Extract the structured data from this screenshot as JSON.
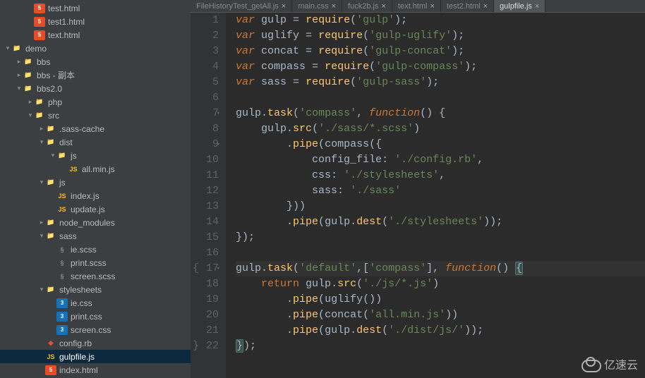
{
  "tabs": [
    {
      "label": "FileHistoryTest_getAll.js",
      "active": false,
      "closeable": true
    },
    {
      "label": "main.css",
      "active": false,
      "closeable": true
    },
    {
      "label": "fuck2b.js",
      "active": false,
      "closeable": true
    },
    {
      "label": "text.html",
      "active": false,
      "closeable": true
    },
    {
      "label": "test2.html",
      "active": false,
      "closeable": true
    },
    {
      "label": "gulpfile.js",
      "active": true,
      "closeable": true
    }
  ],
  "sidebar": {
    "tree": [
      {
        "depth": 2,
        "arrow": "",
        "icon": "html5",
        "iconText": "5",
        "name": "test.html"
      },
      {
        "depth": 2,
        "arrow": "",
        "icon": "html5",
        "iconText": "5",
        "name": "test1.html"
      },
      {
        "depth": 2,
        "arrow": "",
        "icon": "html5",
        "iconText": "5",
        "name": "text.html"
      },
      {
        "depth": 0,
        "arrow": "▾",
        "icon": "folder",
        "iconText": "📁",
        "name": "demo"
      },
      {
        "depth": 1,
        "arrow": "▸",
        "icon": "folder",
        "iconText": "📁",
        "name": "bbs"
      },
      {
        "depth": 1,
        "arrow": "▸",
        "icon": "folder",
        "iconText": "📁",
        "name": "bbs - 副本"
      },
      {
        "depth": 1,
        "arrow": "▾",
        "icon": "folder",
        "iconText": "📁",
        "name": "bbs2.0"
      },
      {
        "depth": 2,
        "arrow": "▸",
        "icon": "folder",
        "iconText": "📁",
        "name": "php"
      },
      {
        "depth": 2,
        "arrow": "▾",
        "icon": "folder",
        "iconText": "📁",
        "name": "src"
      },
      {
        "depth": 3,
        "arrow": "▸",
        "icon": "folder",
        "iconText": "📁",
        "name": ".sass-cache"
      },
      {
        "depth": 3,
        "arrow": "▾",
        "icon": "folder",
        "iconText": "📁",
        "name": "dist"
      },
      {
        "depth": 4,
        "arrow": "▾",
        "icon": "folder",
        "iconText": "📁",
        "name": "js"
      },
      {
        "depth": 5,
        "arrow": "",
        "icon": "js",
        "iconText": "JS",
        "name": "all.min.js"
      },
      {
        "depth": 3,
        "arrow": "▾",
        "icon": "folder",
        "iconText": "📁",
        "name": "js"
      },
      {
        "depth": 4,
        "arrow": "",
        "icon": "js",
        "iconText": "JS",
        "name": "index.js"
      },
      {
        "depth": 4,
        "arrow": "",
        "icon": "js",
        "iconText": "JS",
        "name": "update.js"
      },
      {
        "depth": 3,
        "arrow": "▸",
        "icon": "folder",
        "iconText": "📁",
        "name": "node_modules"
      },
      {
        "depth": 3,
        "arrow": "▾",
        "icon": "folder",
        "iconText": "📁",
        "name": "sass"
      },
      {
        "depth": 4,
        "arrow": "",
        "icon": "sass",
        "iconText": "§",
        "name": "ie.scss"
      },
      {
        "depth": 4,
        "arrow": "",
        "icon": "sass",
        "iconText": "§",
        "name": "print.scss"
      },
      {
        "depth": 4,
        "arrow": "",
        "icon": "sass",
        "iconText": "§",
        "name": "screen.scss"
      },
      {
        "depth": 3,
        "arrow": "▾",
        "icon": "folder",
        "iconText": "📁",
        "name": "stylesheets"
      },
      {
        "depth": 4,
        "arrow": "",
        "icon": "css",
        "iconText": "3",
        "name": "ie.css"
      },
      {
        "depth": 4,
        "arrow": "",
        "icon": "css",
        "iconText": "3",
        "name": "print.css"
      },
      {
        "depth": 4,
        "arrow": "",
        "icon": "css",
        "iconText": "3",
        "name": "screen.css"
      },
      {
        "depth": 3,
        "arrow": "",
        "icon": "ruby",
        "iconText": "◆",
        "name": "config.rb"
      },
      {
        "depth": 3,
        "arrow": "",
        "icon": "js",
        "iconText": "JS",
        "name": "gulpfile.js",
        "selected": true
      },
      {
        "depth": 3,
        "arrow": "",
        "icon": "html5",
        "iconText": "5",
        "name": "index.html"
      }
    ]
  },
  "editor": {
    "filename": "gulpfile.js",
    "cursorLine": 17,
    "lines": [
      {
        "n": 1,
        "fold": false,
        "tokens": [
          [
            "kw",
            "var"
          ],
          [
            "op",
            " "
          ],
          [
            "id",
            "gulp"
          ],
          [
            "op",
            " = "
          ],
          [
            "meth",
            "require"
          ],
          [
            "paren",
            "("
          ],
          [
            "str",
            "'gulp'"
          ],
          [
            "paren",
            ")"
          ],
          [
            "op",
            ";"
          ]
        ]
      },
      {
        "n": 2,
        "fold": false,
        "tokens": [
          [
            "kw",
            "var"
          ],
          [
            "op",
            " "
          ],
          [
            "id",
            "uglify"
          ],
          [
            "op",
            " = "
          ],
          [
            "meth",
            "require"
          ],
          [
            "paren",
            "("
          ],
          [
            "str",
            "'gulp-uglify'"
          ],
          [
            "paren",
            ")"
          ],
          [
            "op",
            ";"
          ]
        ]
      },
      {
        "n": 3,
        "fold": false,
        "tokens": [
          [
            "kw",
            "var"
          ],
          [
            "op",
            " "
          ],
          [
            "id",
            "concat"
          ],
          [
            "op",
            " = "
          ],
          [
            "meth",
            "require"
          ],
          [
            "paren",
            "("
          ],
          [
            "str",
            "'gulp-concat'"
          ],
          [
            "paren",
            ")"
          ],
          [
            "op",
            ";"
          ]
        ]
      },
      {
        "n": 4,
        "fold": false,
        "tokens": [
          [
            "kw",
            "var"
          ],
          [
            "op",
            " "
          ],
          [
            "id",
            "compass"
          ],
          [
            "op",
            " = "
          ],
          [
            "meth",
            "require"
          ],
          [
            "paren",
            "("
          ],
          [
            "str",
            "'gulp-compass'"
          ],
          [
            "paren",
            ")"
          ],
          [
            "op",
            ";"
          ]
        ]
      },
      {
        "n": 5,
        "fold": false,
        "tokens": [
          [
            "kw",
            "var"
          ],
          [
            "op",
            " "
          ],
          [
            "id",
            "sass"
          ],
          [
            "op",
            " = "
          ],
          [
            "meth",
            "require"
          ],
          [
            "paren",
            "("
          ],
          [
            "str",
            "'gulp-sass'"
          ],
          [
            "paren",
            ")"
          ],
          [
            "op",
            ";"
          ]
        ]
      },
      {
        "n": 6,
        "fold": false,
        "tokens": [
          [
            "op",
            ""
          ]
        ]
      },
      {
        "n": 7,
        "fold": true,
        "tokens": [
          [
            "id",
            "gulp"
          ],
          [
            "dot",
            "."
          ],
          [
            "meth",
            "task"
          ],
          [
            "paren",
            "("
          ],
          [
            "str",
            "'compass'"
          ],
          [
            "op",
            ", "
          ],
          [
            "fn-lit",
            "function"
          ],
          [
            "paren",
            "()"
          ],
          [
            "op",
            " {"
          ]
        ]
      },
      {
        "n": 8,
        "fold": false,
        "tokens": [
          [
            "op",
            "    "
          ],
          [
            "id",
            "gulp"
          ],
          [
            "dot",
            "."
          ],
          [
            "meth",
            "src"
          ],
          [
            "paren",
            "("
          ],
          [
            "str",
            "'./sass/*.scss'"
          ],
          [
            "paren",
            ")"
          ]
        ]
      },
      {
        "n": 9,
        "fold": true,
        "tokens": [
          [
            "op",
            "        "
          ],
          [
            "dot",
            "."
          ],
          [
            "meth",
            "pipe"
          ],
          [
            "paren",
            "("
          ],
          [
            "id",
            "compass"
          ],
          [
            "paren",
            "({"
          ]
        ]
      },
      {
        "n": 10,
        "fold": false,
        "tokens": [
          [
            "op",
            "            "
          ],
          [
            "id",
            "config_file"
          ],
          [
            "op",
            ": "
          ],
          [
            "str",
            "'./config.rb'"
          ],
          [
            "op",
            ","
          ]
        ]
      },
      {
        "n": 11,
        "fold": false,
        "tokens": [
          [
            "op",
            "            "
          ],
          [
            "id",
            "css"
          ],
          [
            "op",
            ": "
          ],
          [
            "str",
            "'./stylesheets'"
          ],
          [
            "op",
            ","
          ]
        ]
      },
      {
        "n": 12,
        "fold": false,
        "tokens": [
          [
            "op",
            "            "
          ],
          [
            "id",
            "sass"
          ],
          [
            "op",
            ": "
          ],
          [
            "str",
            "'./sass'"
          ]
        ]
      },
      {
        "n": 13,
        "fold": false,
        "tokens": [
          [
            "op",
            "        }"
          ],
          [
            "paren",
            "))"
          ]
        ]
      },
      {
        "n": 14,
        "fold": false,
        "tokens": [
          [
            "op",
            "        "
          ],
          [
            "dot",
            "."
          ],
          [
            "meth",
            "pipe"
          ],
          [
            "paren",
            "("
          ],
          [
            "id",
            "gulp"
          ],
          [
            "dot",
            "."
          ],
          [
            "meth",
            "dest"
          ],
          [
            "paren",
            "("
          ],
          [
            "str",
            "'./stylesheets'"
          ],
          [
            "paren",
            "))"
          ],
          [
            "op",
            ";"
          ]
        ]
      },
      {
        "n": 15,
        "fold": false,
        "tokens": [
          [
            "op",
            "}"
          ],
          [
            "paren",
            ")"
          ],
          [
            "op",
            ";"
          ]
        ]
      },
      {
        "n": 16,
        "fold": false,
        "tokens": [
          [
            "op",
            ""
          ]
        ]
      },
      {
        "n": 17,
        "fold": true,
        "hl": true,
        "braceOpen": true,
        "tokens": [
          [
            "id",
            "gulp"
          ],
          [
            "dot",
            "."
          ],
          [
            "meth",
            "task"
          ],
          [
            "paren",
            "("
          ],
          [
            "str",
            "'default'"
          ],
          [
            "op",
            ",["
          ],
          [
            "str",
            "'compass'"
          ],
          [
            "op",
            "], "
          ],
          [
            "fn-lit",
            "function"
          ],
          [
            "paren",
            "()"
          ],
          [
            "op",
            " "
          ],
          [
            "brace-match",
            "{"
          ]
        ]
      },
      {
        "n": 18,
        "fold": false,
        "tokens": [
          [
            "op",
            "    "
          ],
          [
            "kw2",
            "return"
          ],
          [
            "op",
            " "
          ],
          [
            "id",
            "gulp"
          ],
          [
            "dot",
            "."
          ],
          [
            "meth",
            "src"
          ],
          [
            "paren",
            "("
          ],
          [
            "str",
            "'./js/*.js'"
          ],
          [
            "paren",
            ")"
          ]
        ]
      },
      {
        "n": 19,
        "fold": false,
        "tokens": [
          [
            "op",
            "        "
          ],
          [
            "dot",
            "."
          ],
          [
            "meth",
            "pipe"
          ],
          [
            "paren",
            "("
          ],
          [
            "id",
            "uglify"
          ],
          [
            "paren",
            "())"
          ]
        ]
      },
      {
        "n": 20,
        "fold": false,
        "tokens": [
          [
            "op",
            "        "
          ],
          [
            "dot",
            "."
          ],
          [
            "meth",
            "pipe"
          ],
          [
            "paren",
            "("
          ],
          [
            "id",
            "concat"
          ],
          [
            "paren",
            "("
          ],
          [
            "str",
            "'all.min.js'"
          ],
          [
            "paren",
            "))"
          ]
        ]
      },
      {
        "n": 21,
        "fold": false,
        "tokens": [
          [
            "op",
            "        "
          ],
          [
            "dot",
            "."
          ],
          [
            "meth",
            "pipe"
          ],
          [
            "paren",
            "("
          ],
          [
            "id",
            "gulp"
          ],
          [
            "dot",
            "."
          ],
          [
            "meth",
            "dest"
          ],
          [
            "paren",
            "("
          ],
          [
            "str",
            "'./dist/js/'"
          ],
          [
            "paren",
            "))"
          ],
          [
            "op",
            ";"
          ]
        ]
      },
      {
        "n": 22,
        "fold": false,
        "braceClose": true,
        "tokens": [
          [
            "brace-match",
            "}"
          ],
          [
            "paren",
            ")"
          ],
          [
            "op",
            ";"
          ]
        ]
      }
    ]
  },
  "watermark": {
    "text": "亿速云"
  }
}
